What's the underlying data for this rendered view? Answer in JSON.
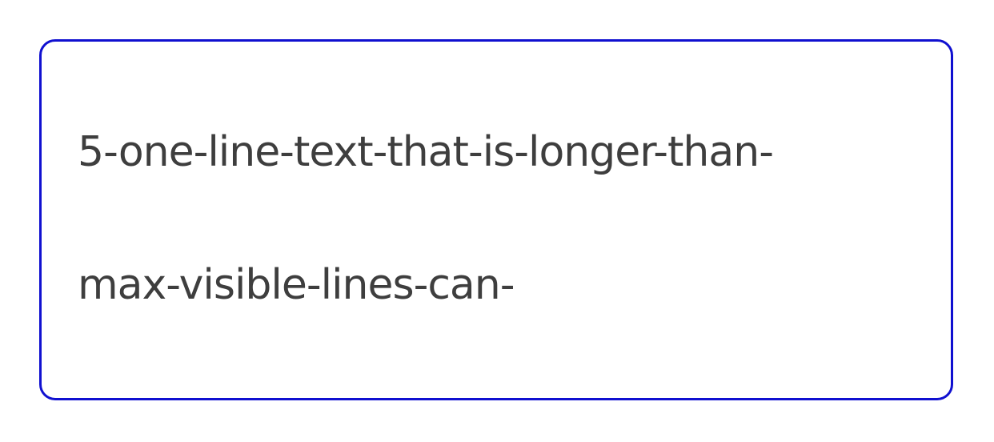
{
  "textbox": {
    "lines": [
      "5-one-line-text-that-is-longer-than-",
      "max-visible-lines-can-"
    ]
  },
  "colors": {
    "border": "#1010d0",
    "text": "#3e3e3e",
    "background": "#ffffff"
  }
}
